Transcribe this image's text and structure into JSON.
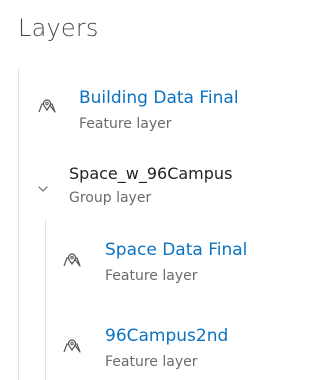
{
  "panel": {
    "title": "Layers"
  },
  "layers": [
    {
      "title": "Building Data Final",
      "subtitle": "Feature layer",
      "icon": "map-pin-icon"
    },
    {
      "title": "Space_w_96Campus",
      "subtitle": "Group layer",
      "icon": "chevron-down-icon",
      "children": [
        {
          "title": "Space Data Final",
          "subtitle": "Feature layer",
          "icon": "map-pin-icon"
        },
        {
          "title": "96Campus2nd",
          "subtitle": "Feature layer",
          "icon": "map-pin-icon"
        }
      ]
    }
  ],
  "colors": {
    "link": "#0b73c1",
    "muted": "#6b6b6b",
    "rule": "#e2e2e2"
  }
}
